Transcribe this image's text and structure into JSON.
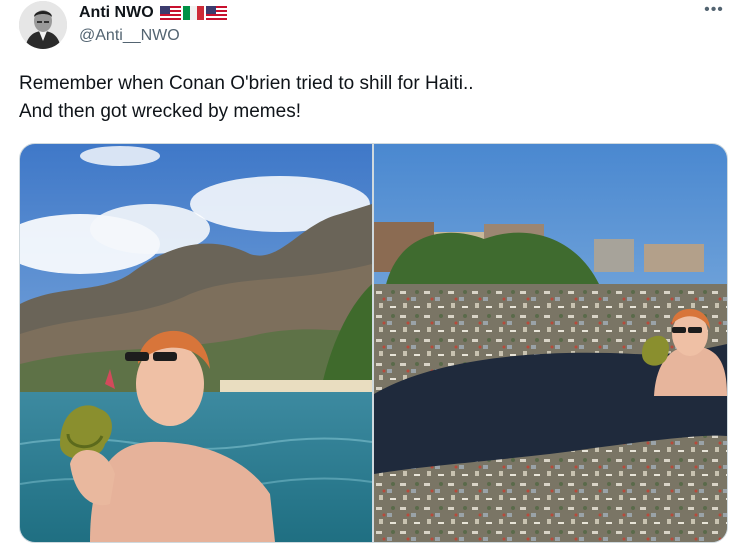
{
  "tweet": {
    "author": {
      "display_name": "Anti NWO",
      "handle": "@Anti__NWO",
      "flags": [
        "us-flag-icon",
        "italy-flag-icon",
        "us-flag-icon"
      ]
    },
    "more_label": "•••",
    "text_lines": [
      "Remember when Conan O'brien tried to shill for Haiti..",
      "And then got wrecked by memes!"
    ],
    "media": [
      {
        "name": "resort-photo",
        "kind": "photo"
      },
      {
        "name": "trash-water-photo",
        "kind": "photo"
      }
    ]
  },
  "colors": {
    "text_primary": "#0f1419",
    "text_secondary": "#536471",
    "border": "#cfd9de"
  }
}
